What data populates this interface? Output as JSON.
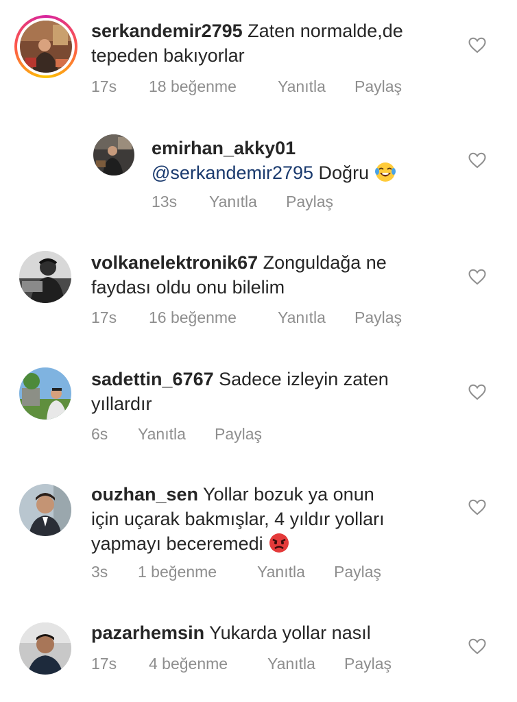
{
  "comments": [
    {
      "username": "serkandemir2795",
      "text_line1": "Zaten normalde,de",
      "text_line2": "tepeden bakıyorlar",
      "time": "17s",
      "likes": "18 beğenme",
      "reply": "Yanıtla",
      "share": "Paylaş"
    },
    {
      "username": "emirhan_akky01",
      "mention": "@serkandemir2795",
      "text": "Doğru",
      "time": "13s",
      "reply": "Yanıtla",
      "share": "Paylaş"
    },
    {
      "username": "volkanelektronik67",
      "text_line1": "Zonguldağa ne",
      "text_line2": "faydası oldu onu bilelim",
      "time": "17s",
      "likes": "16 beğenme",
      "reply": "Yanıtla",
      "share": "Paylaş"
    },
    {
      "username": "sadettin_6767",
      "text_line1": "Sadece izleyin zaten",
      "text_line2": "yıllardır",
      "time": "6s",
      "reply": "Yanıtla",
      "share": "Paylaş"
    },
    {
      "username": "ouzhan_sen",
      "text_line1": "Yollar bozuk ya onun",
      "text_line2": "için uçarak bakmışlar, 4 yıldır yolları",
      "text_line3": "yapmayı beceremedi",
      "time": "3s",
      "likes": "1 beğenme",
      "reply": "Yanıtla",
      "share": "Paylaş"
    },
    {
      "username": "pazarhemsin",
      "text_line1": "Yukarda yollar nasıl",
      "time": "17s",
      "likes": "4 beğenme",
      "reply": "Yanıtla",
      "share": "Paylaş"
    }
  ],
  "icons": {
    "like": "heart-outline-icon",
    "laugh_emoji": "face-with-tears-of-joy",
    "angry_emoji": "pouting-face"
  },
  "colors": {
    "text": "#262626",
    "meta": "#8e8e8e",
    "mention": "#1a3a6e"
  }
}
